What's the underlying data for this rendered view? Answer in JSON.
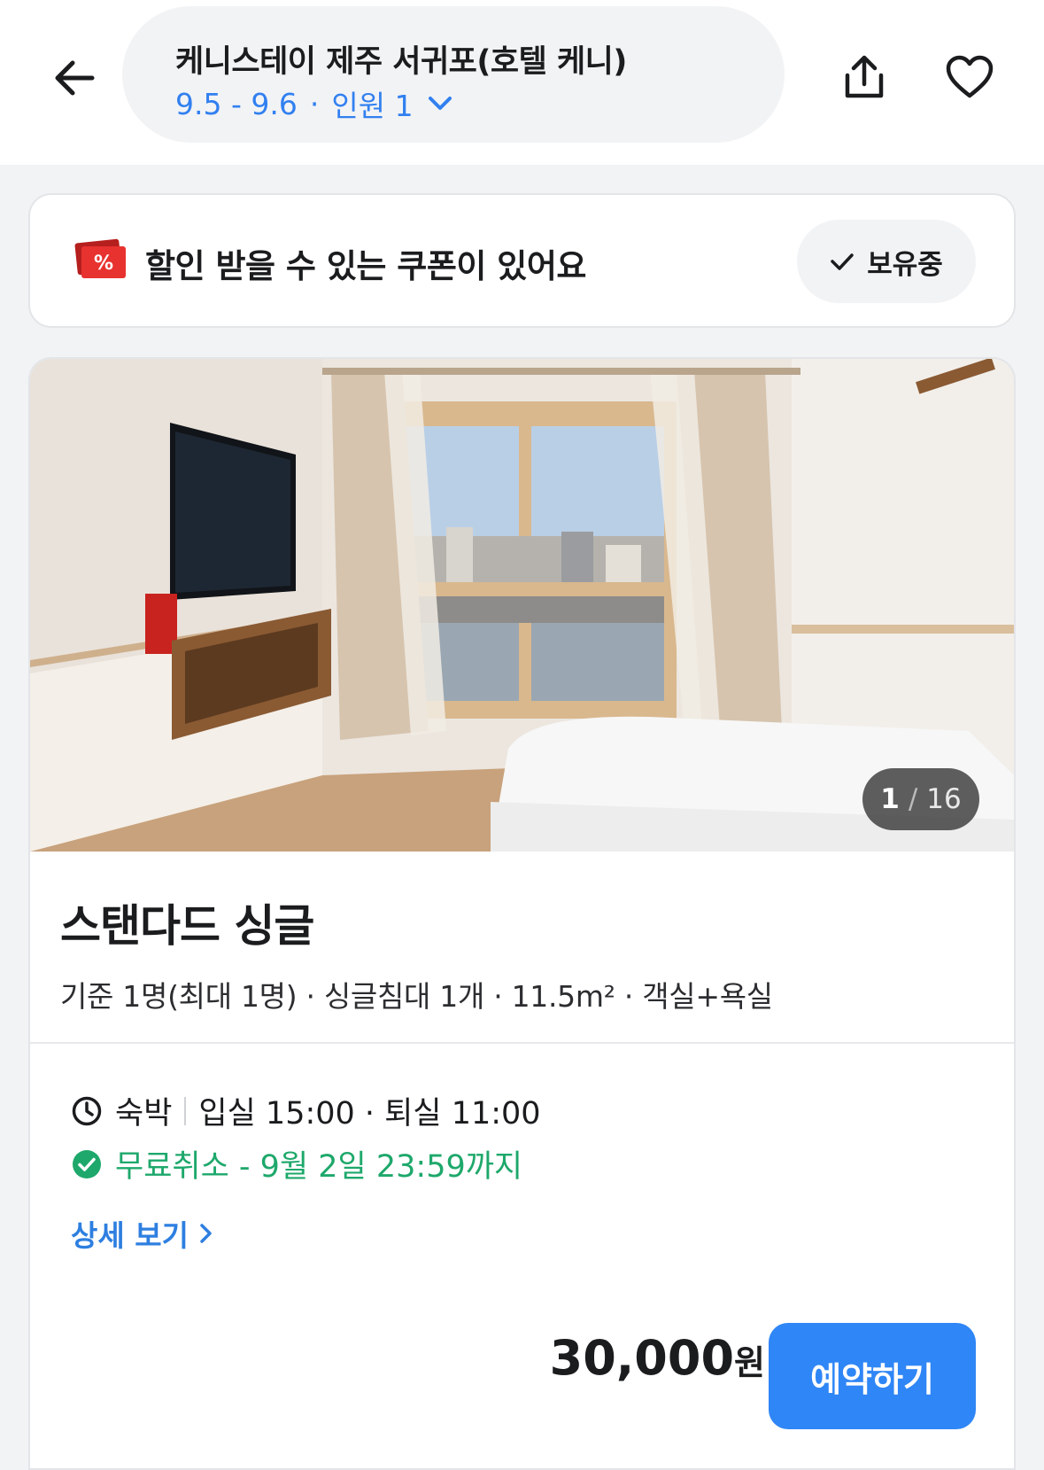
{
  "header": {
    "hotel_name": "케니스테이 제주 서귀포(호텔 케니)",
    "dates": "9.5 - 9.6",
    "separator": "·",
    "guests": "인원 1"
  },
  "coupon": {
    "icon_symbol": "%",
    "message": "할인 받을 수 있는 쿠폰이 있어요",
    "owned_label": "보유중"
  },
  "room": {
    "photo_current": "1",
    "photo_separator": "/",
    "photo_total": "16",
    "name": "스탠다드 싱글",
    "specs": "기준 1명(최대 1명) · 싱글침대 1개 · 11.5m² · 객실+욕실",
    "stay_type": "숙박",
    "check_times": "입실 15:00 · 퇴실 11:00",
    "free_cancel": "무료취소 - 9월 2일 23:59까지",
    "detail_link": "상세 보기",
    "price": "30,000",
    "price_unit": "원",
    "book_label": "예약하기"
  },
  "colors": {
    "accent_blue": "#2f86f6",
    "link_blue": "#3180f0",
    "cancel_green": "#1ea86b",
    "coupon_red": "#e8322f"
  }
}
